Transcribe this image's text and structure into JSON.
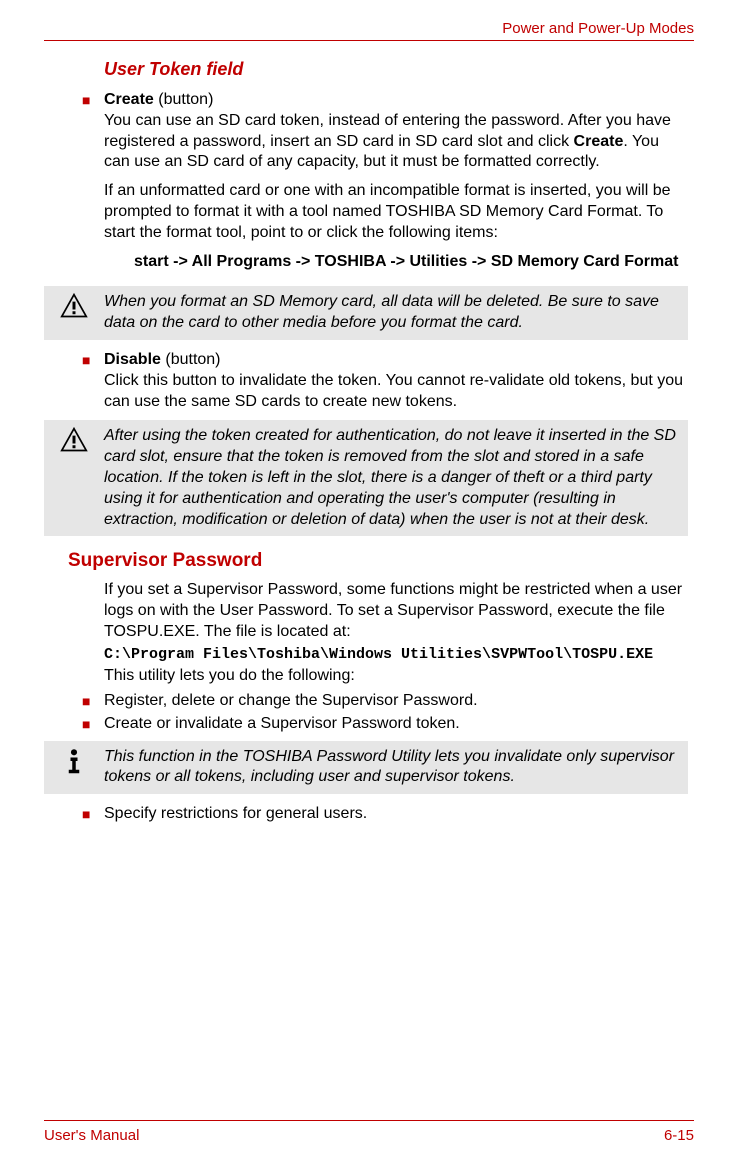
{
  "header": {
    "chapter": "Power and Power-Up Modes"
  },
  "section1": {
    "title": "User Token field",
    "b1_label": "Create",
    "b1_suffix": " (button)",
    "b1_p1": "You can use an SD card token, instead of entering the password. After you have registered a password, insert an SD card in SD card slot and click ",
    "b1_p1_bold": "Create",
    "b1_p1_end": ". You can use an SD card of any capacity, but it must be formatted correctly.",
    "b1_p2": "If an unformatted card or one with an incompatible format is inserted, you will be prompted to format it with a tool named TOSHIBA SD Memory Card Format. To start the format tool, point to or click the following items:",
    "b1_path": "start -> All Programs -> TOSHIBA -> Utilities -> SD Memory Card Format",
    "warn1": "When you format an SD Memory card, all data will be deleted. Be sure to save data on the card to other media before you format the card.",
    "b2_label": "Disable",
    "b2_suffix": " (button)",
    "b2_p1": "Click this button to invalidate the token. You cannot re-validate old tokens, but you can use the same SD cards to create new tokens.",
    "warn2": "After using the token created for authentication, do not leave it inserted in the SD card slot, ensure that the token is removed from the slot and stored in a safe location. If the token is left in the slot, there is a danger of theft or a third party using it for authentication and operating the user's computer (resulting in extraction, modification or deletion of data) when the user is not at their desk."
  },
  "section2": {
    "title": "Supervisor Password",
    "p1": "If you set a Supervisor Password, some functions might be restricted when a user logs on with the User Password. To set a Supervisor Password, execute the file TOSPU.EXE. The file is located at:",
    "path": "C:\\Program Files\\Toshiba\\Windows Utilities\\SVPWTool\\TOSPU.EXE",
    "p2": "This utility lets you do the following:",
    "li1": "Register, delete or change the Supervisor Password.",
    "li2": "Create or invalidate a Supervisor Password token.",
    "info": "This function in the TOSHIBA Password Utility lets you invalidate only supervisor tokens or all tokens, including user and supervisor tokens.",
    "li3": "Specify restrictions for general users."
  },
  "footer": {
    "left": "User's Manual",
    "right": "6-15"
  }
}
